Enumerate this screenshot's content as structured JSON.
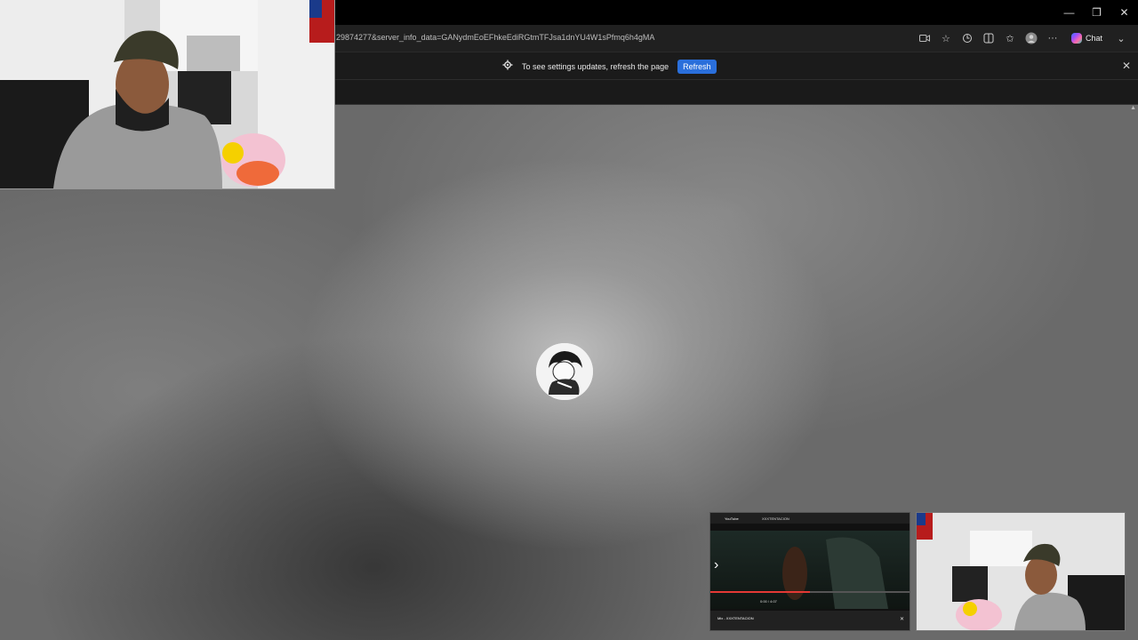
{
  "browser": {
    "url_text": "29874277&server_info_data=GANydmEoEFhkeEdiRGtmTFJsa1dnYU4W1sPfmq6h4gMA",
    "chat_label": "Chat",
    "icons": [
      "video-icon",
      "favorite-star-icon",
      "extensions-icon",
      "split-screen-icon",
      "collections-icon",
      "profile-icon",
      "more-icon",
      "copilot-icon",
      "chevron-down-icon"
    ]
  },
  "window_controls": {
    "minimize": "—",
    "maximize": "❐",
    "close": "✕"
  },
  "infobar": {
    "message": "To see settings updates, refresh the page",
    "refresh_label": "Refresh",
    "close_glyph": "✕"
  },
  "thumbnail_youtube": {
    "brand": "YouTube",
    "search_text": "XXXTENTACION",
    "time": "0:00 / 4:07",
    "now_playing": "Mix - XXXTENTACION"
  },
  "colors": {
    "accent": "#2a6fdb",
    "background": "#000000"
  }
}
